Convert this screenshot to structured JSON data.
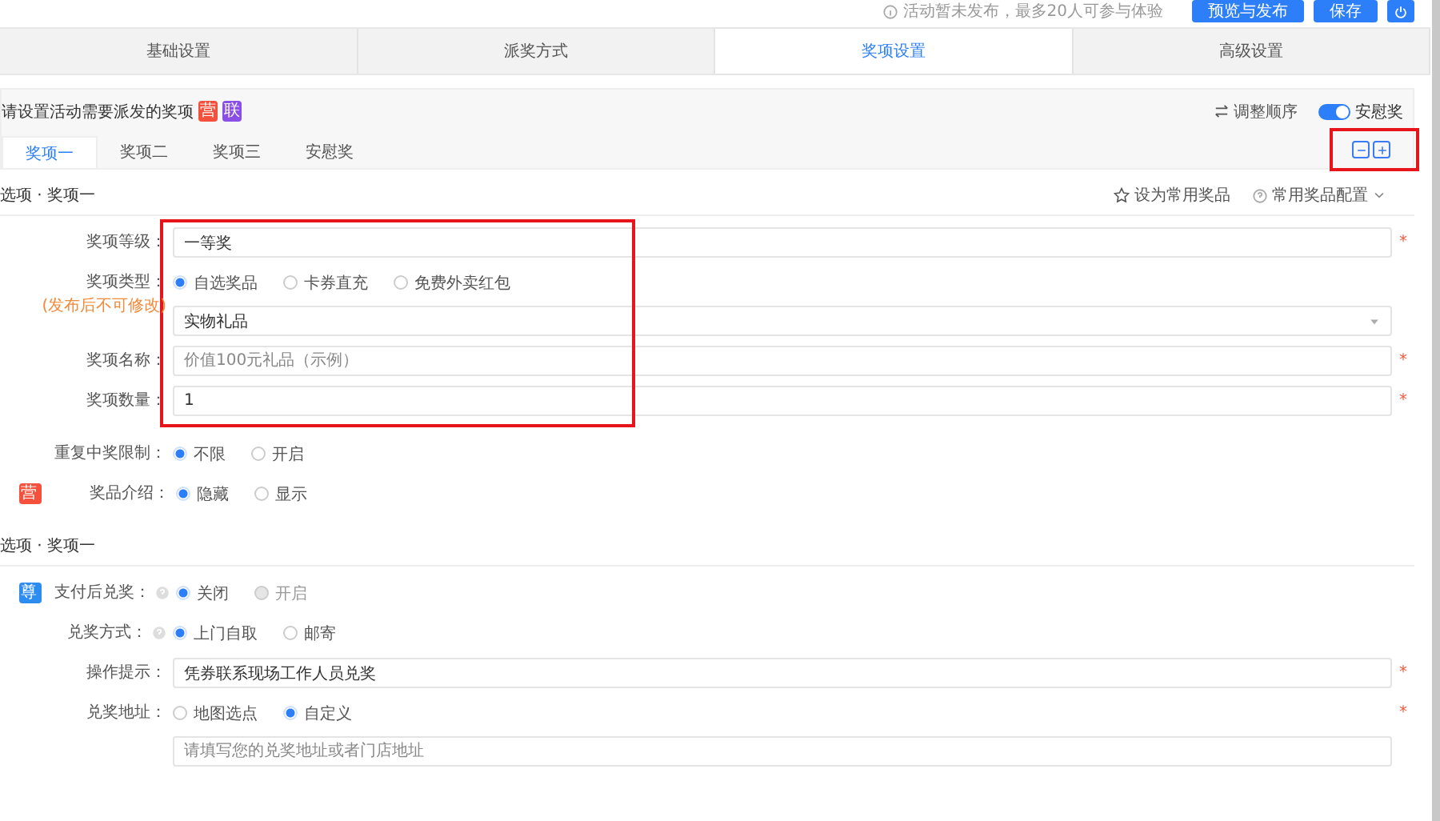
{
  "top_bar": {
    "notice": "活动暂未发布，最多20人可参与体验",
    "buttons": [
      {
        "label": "预览与发布",
        "kind": "primary"
      },
      {
        "label": "保存",
        "kind": "primary"
      },
      {
        "kind": "power"
      }
    ]
  },
  "tabs": [
    {
      "label": "基础设置",
      "selected": false
    },
    {
      "label": "派奖方式",
      "selected": false
    },
    {
      "label": "奖项设置",
      "selected": true
    },
    {
      "label": "高级设置",
      "selected": false
    }
  ],
  "prize_panel": {
    "title": "请设置活动需要派发的奖项",
    "badges": [
      {
        "label": "营",
        "color": "#f5503c"
      },
      {
        "label": "联",
        "color": "#8a4fe6"
      }
    ],
    "reorder": "调整顺序",
    "consolation_toggle": {
      "label": "安慰奖",
      "on": true
    },
    "prize_tabs": [
      {
        "label": "奖项一",
        "selected": true
      },
      {
        "label": "奖项二",
        "selected": false
      },
      {
        "label": "奖项三",
        "selected": false
      },
      {
        "label": "安慰奖",
        "selected": false
      }
    ],
    "tab_controls_highlighted": true
  },
  "sections": [
    {
      "title": "选项 · 奖项一",
      "actions": [
        {
          "label": "设为常用奖品",
          "kind": "star"
        },
        {
          "label": "常用奖品配置",
          "kind": "help-dropdown"
        }
      ],
      "blocks": [
        {
          "highlighted": true,
          "rows": [
            {
              "label": "奖项等级：",
              "input": {
                "value": "一等奖"
              },
              "required_mark": "*"
            },
            {
              "label": "奖项类型：",
              "sublabel": "(发布后不可修改)",
              "radios": [
                {
                  "label": "自选奖品",
                  "selected": true,
                  "disabled": false
                },
                {
                  "label": "卡券直充",
                  "selected": false,
                  "disabled": false
                },
                {
                  "label": "免费外卖红包",
                  "selected": false,
                  "disabled": false
                }
              ],
              "select": {
                "value": "实物礼品"
              }
            },
            {
              "label": "奖项名称：",
              "input": {
                "placeholder": "价值100元礼品（示例）"
              },
              "required_mark": "*"
            },
            {
              "label": "奖项数量：",
              "input": {
                "value": "1"
              },
              "required_mark": "*"
            }
          ]
        },
        {
          "rows": [
            {
              "label": "重复中奖限制：",
              "radios": [
                {
                  "label": "不限",
                  "selected": true,
                  "disabled": false
                },
                {
                  "label": "开启",
                  "selected": false,
                  "disabled": false
                }
              ]
            },
            {
              "label": "奖品介绍：",
              "icon": {
                "label": "营",
                "color": "#f5503c"
              },
              "radios": [
                {
                  "label": "隐藏",
                  "selected": true,
                  "disabled": false
                },
                {
                  "label": "显示",
                  "selected": false,
                  "disabled": false
                }
              ]
            }
          ]
        }
      ]
    },
    {
      "title": "选项 · 奖项一",
      "blocks": [
        {
          "rows": [
            {
              "label": "支付后兑奖：",
              "icon": {
                "label": "尊",
                "color": "#2d8cf0"
              },
              "help": true,
              "radios": [
                {
                  "label": "关闭",
                  "selected": true,
                  "disabled": false
                },
                {
                  "label": "开启",
                  "selected": false,
                  "disabled": true
                }
              ]
            },
            {
              "label": "兑奖方式：",
              "help": true,
              "radios": [
                {
                  "label": "上门自取",
                  "selected": true,
                  "disabled": false
                },
                {
                  "label": "邮寄",
                  "selected": false,
                  "disabled": false
                }
              ]
            },
            {
              "label": "操作提示：",
              "input": {
                "value": "凭券联系现场工作人员兑奖"
              },
              "required_mark": "*"
            },
            {
              "label": "兑奖地址：",
              "radios": [
                {
                  "label": "地图选点",
                  "selected": false,
                  "disabled": false
                },
                {
                  "label": "自定义",
                  "selected": true,
                  "disabled": false
                }
              ],
              "input": {
                "placeholder": "请填写您的兑奖地址或者门店地址"
              },
              "required_mark": "*"
            }
          ]
        }
      ]
    }
  ]
}
